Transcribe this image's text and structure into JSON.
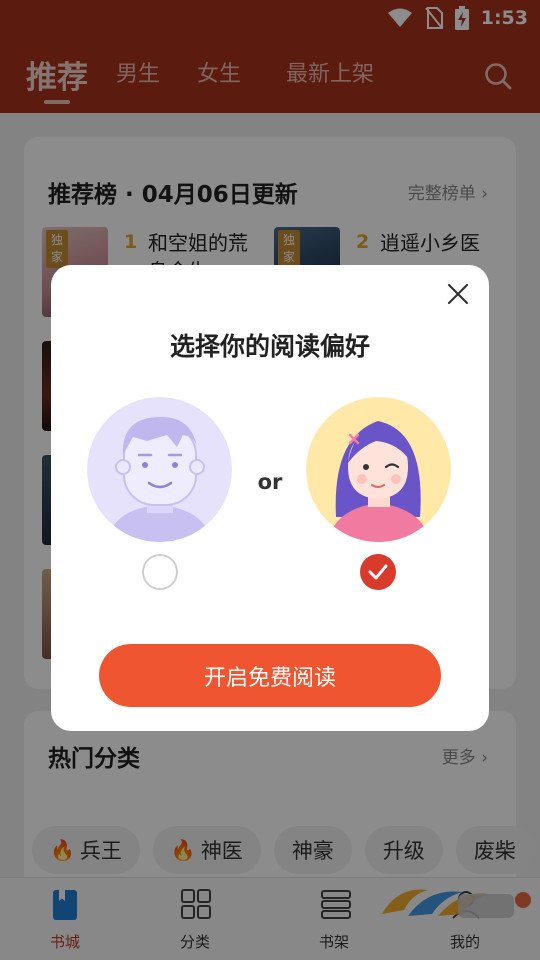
{
  "status_bar": {
    "time": "1:53",
    "icons": [
      "wifi-icon",
      "no-sim-icon",
      "battery-charging-icon"
    ]
  },
  "top_nav": {
    "tabs": [
      {
        "label": "推荐",
        "active": true
      },
      {
        "label": "男生",
        "active": false
      },
      {
        "label": "女生",
        "active": false
      },
      {
        "label": "最新上架",
        "active": false
      }
    ],
    "search_icon": "search-icon",
    "background_color": "#a7321a"
  },
  "ranking_card": {
    "title": "推荐榜 · 04月06日更新",
    "more_label": "完整榜单 ›",
    "books": [
      {
        "rank": "1",
        "title": "和空姐的荒岛余生",
        "badge": "独家"
      },
      {
        "rank": "2",
        "title": "逍遥小乡医",
        "badge": "独家"
      }
    ]
  },
  "category_card": {
    "title": "热门分类",
    "more_label": "更多 ›",
    "chips": [
      {
        "label": "兵王",
        "hot": true
      },
      {
        "label": "神医",
        "hot": true
      },
      {
        "label": "神豪",
        "hot": false
      },
      {
        "label": "升级",
        "hot": false
      },
      {
        "label": "废柴",
        "hot": false
      }
    ]
  },
  "bottom_nav": {
    "items": [
      {
        "label": "书城",
        "icon": "bookstore-icon",
        "active": true
      },
      {
        "label": "分类",
        "icon": "category-grid-icon",
        "active": false
      },
      {
        "label": "书架",
        "icon": "bookshelf-icon",
        "active": false
      },
      {
        "label": "我的",
        "icon": "profile-icon",
        "active": false
      }
    ]
  },
  "preference_dialog": {
    "title": "选择你的阅读偏好",
    "separator": "or",
    "options": [
      {
        "gender": "male",
        "selected": false
      },
      {
        "gender": "female",
        "selected": true
      }
    ],
    "cta_label": "开启免费阅读",
    "accent_color": "#ef5530"
  }
}
